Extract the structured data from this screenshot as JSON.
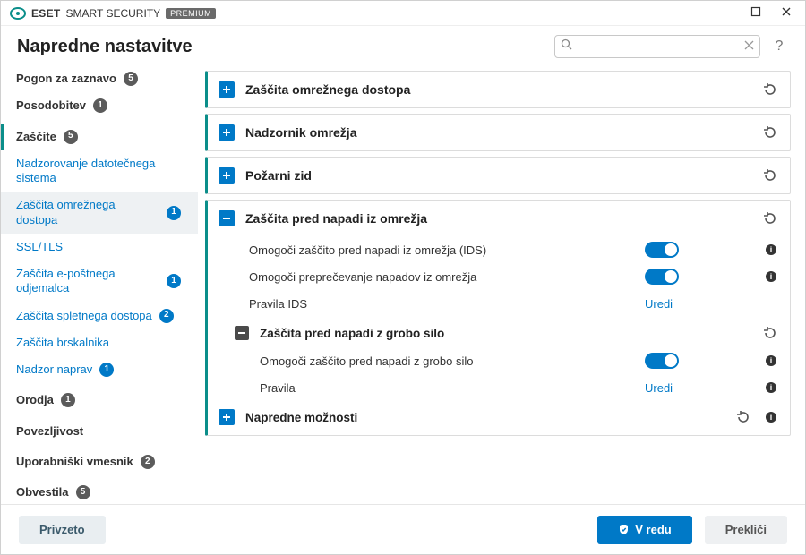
{
  "brand": {
    "eset": "ESET",
    "product": "SMART SECURITY",
    "edition": "PREMIUM"
  },
  "header": {
    "title": "Napredne nastavitve",
    "search_placeholder": "",
    "help_glyph": "?"
  },
  "sidebar": {
    "items": [
      {
        "label": "Pogon za zaznavo",
        "badge": "5"
      },
      {
        "label": "Posodobitev",
        "badge": "1"
      },
      {
        "label": "Zaščite",
        "badge": "5",
        "children": [
          {
            "label": "Nadzorovanje datotečnega sistema"
          },
          {
            "label": "Zaščita omrežnega dostopa",
            "badge": "1",
            "selected": true
          },
          {
            "label": "SSL/TLS"
          },
          {
            "label": "Zaščita e-poštnega odjemalca",
            "badge": "1"
          },
          {
            "label": "Zaščita spletnega dostopa",
            "badge": "2"
          },
          {
            "label": "Zaščita brskalnika"
          },
          {
            "label": "Nadzor naprav",
            "badge": "1"
          }
        ]
      },
      {
        "label": "Orodja",
        "badge": "1"
      },
      {
        "label": "Povezljivost"
      },
      {
        "label": "Uporabniški vmesnik",
        "badge": "2"
      },
      {
        "label": "Obvestila",
        "badge": "5"
      }
    ]
  },
  "content": {
    "panels": [
      {
        "title": "Zaščita omrežnega dostopa",
        "expanded": false
      },
      {
        "title": "Nadzornik omrežja",
        "expanded": false
      },
      {
        "title": "Požarni zid",
        "expanded": false
      },
      {
        "title": "Zaščita pred napadi iz omrežja",
        "expanded": true,
        "settings": [
          {
            "label": "Omogoči zaščito pred napadi iz omrežja (IDS)",
            "value": true
          },
          {
            "label": "Omogoči preprečevanje napadov iz omrežja",
            "value": true
          },
          {
            "label": "Pravila IDS",
            "action": "Uredi"
          }
        ],
        "sub": {
          "title": "Zaščita pred napadi z grobo silo",
          "expanded": true,
          "settings": [
            {
              "label": "Omogoči zaščito pred napadi z grobo silo",
              "value": true
            },
            {
              "label": "Pravila",
              "action": "Uredi"
            }
          ]
        },
        "advanced": {
          "title": "Napredne možnosti",
          "expanded": false
        }
      }
    ]
  },
  "footer": {
    "default_label": "Privzeto",
    "ok_label": "V redu",
    "cancel_label": "Prekliči"
  },
  "colors": {
    "accent": "#0b8e8a",
    "link": "#0079c7"
  }
}
